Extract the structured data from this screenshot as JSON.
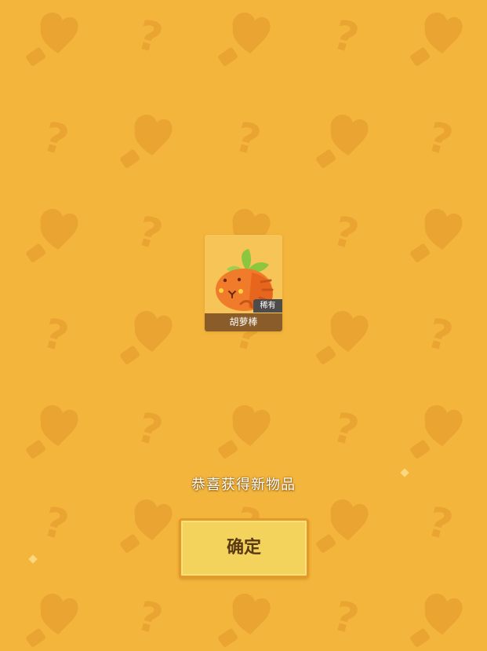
{
  "reward_card": {
    "item_name": "胡萝棒",
    "rarity_label": "稀有",
    "item_icon": "carrot-creature-icon"
  },
  "congrats_text": "恭喜获得新物品",
  "confirm_button_label": "确定",
  "colors": {
    "background": "#F3B53C",
    "pattern": "#E9A431",
    "button_fill": "#F4D35C",
    "button_border": "#E59A28",
    "button_text": "#5A3A14",
    "name_bar": "#8A5C2A",
    "rarity_badge": "#4E4C4A"
  },
  "background_pattern_icons": [
    "heart-icon",
    "question-mark-icon",
    "bottle-icon"
  ]
}
